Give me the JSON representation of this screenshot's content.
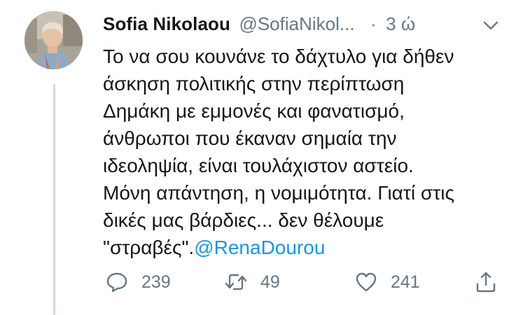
{
  "tweet": {
    "author_name": "Sofia Nikolaou",
    "handle": "@SofiaNikol...",
    "separator": "·",
    "time": "3 ώ",
    "text_lines": [
      "Το να σου κουνάνε το δάχτυλο για δήθεν",
      "άσκηση πολιτικής στην περίπτωση",
      "Δημάκη με εμμονές και φανατισμό,",
      "άνθρωποι που έκαναν σημαία την",
      "ιδεοληψία, είναι τουλάχιστον αστείο.",
      "Μόνη απάντηση, η νομιμότητα. Γιατί στις",
      "δικές μας βάρδιες... δεν θέλουμε"
    ],
    "last_line_text": "\"στραβές\".",
    "mention": "@RenaDourou"
  },
  "actions": {
    "reply_count": "239",
    "retweet_count": "49",
    "like_count": "241"
  },
  "icons": {
    "reply": "reply-icon",
    "retweet": "retweet-icon",
    "like": "like-icon",
    "share": "share-icon",
    "more": "chevron-down-icon"
  },
  "colors": {
    "text": "#14171a",
    "secondary": "#657786",
    "link": "#1b95e0",
    "thread_line": "#cfd9de"
  }
}
